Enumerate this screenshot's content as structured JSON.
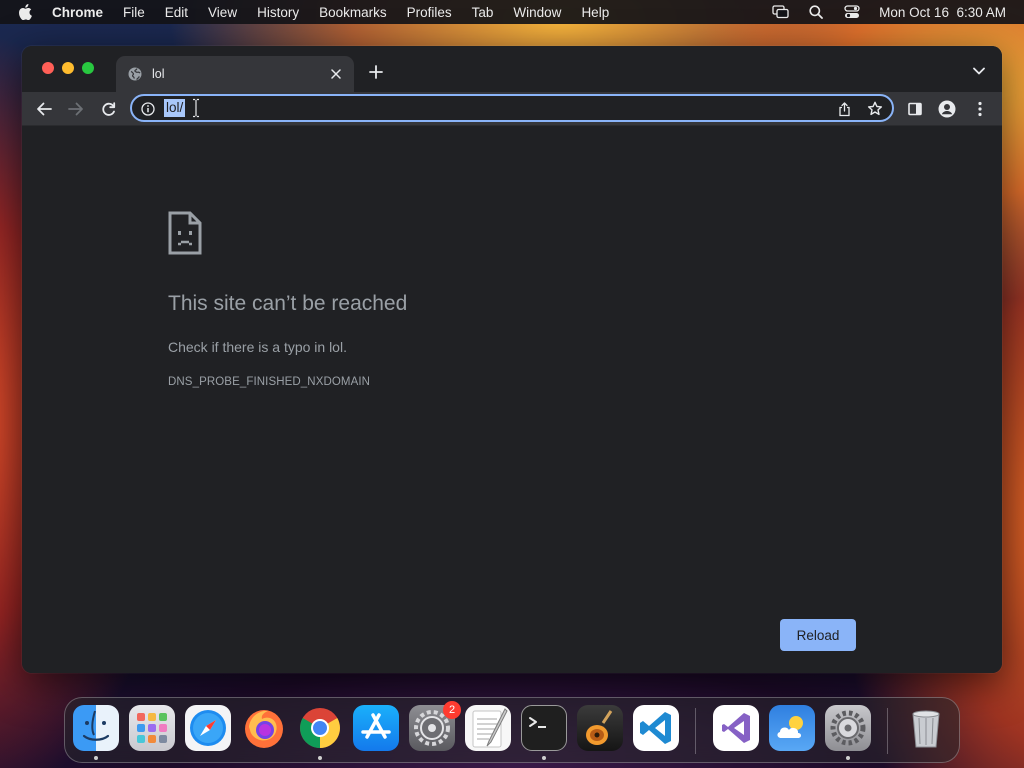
{
  "menubar": {
    "app_name": "Chrome",
    "items": [
      "File",
      "Edit",
      "View",
      "History",
      "Bookmarks",
      "Profiles",
      "Tab",
      "Window",
      "Help"
    ],
    "datetime": "Mon Oct 16  6:30 AM"
  },
  "browser": {
    "tab": {
      "title": "lol"
    },
    "omnibox": {
      "url": "lol/"
    }
  },
  "error_page": {
    "title": "This site can’t be reached",
    "hint": "Check if there is a typo in lol.",
    "code": "DNS_PROBE_FINISHED_NXDOMAIN",
    "reload_label": "Reload"
  },
  "dock": {
    "apps": [
      "finder",
      "launchpad",
      "safari",
      "firefox",
      "chrome",
      "app-store",
      "system-preferences",
      "textedit",
      "terminal",
      "garageband",
      "vscode",
      "visual-studio",
      "weather",
      "settings",
      "trash"
    ],
    "system_preferences_badge": "2"
  },
  "colors": {
    "accent": "#8ab4f8",
    "window_bg": "#202124",
    "toolbar_bg": "#35363a",
    "error_text": "#9aa0a6"
  }
}
